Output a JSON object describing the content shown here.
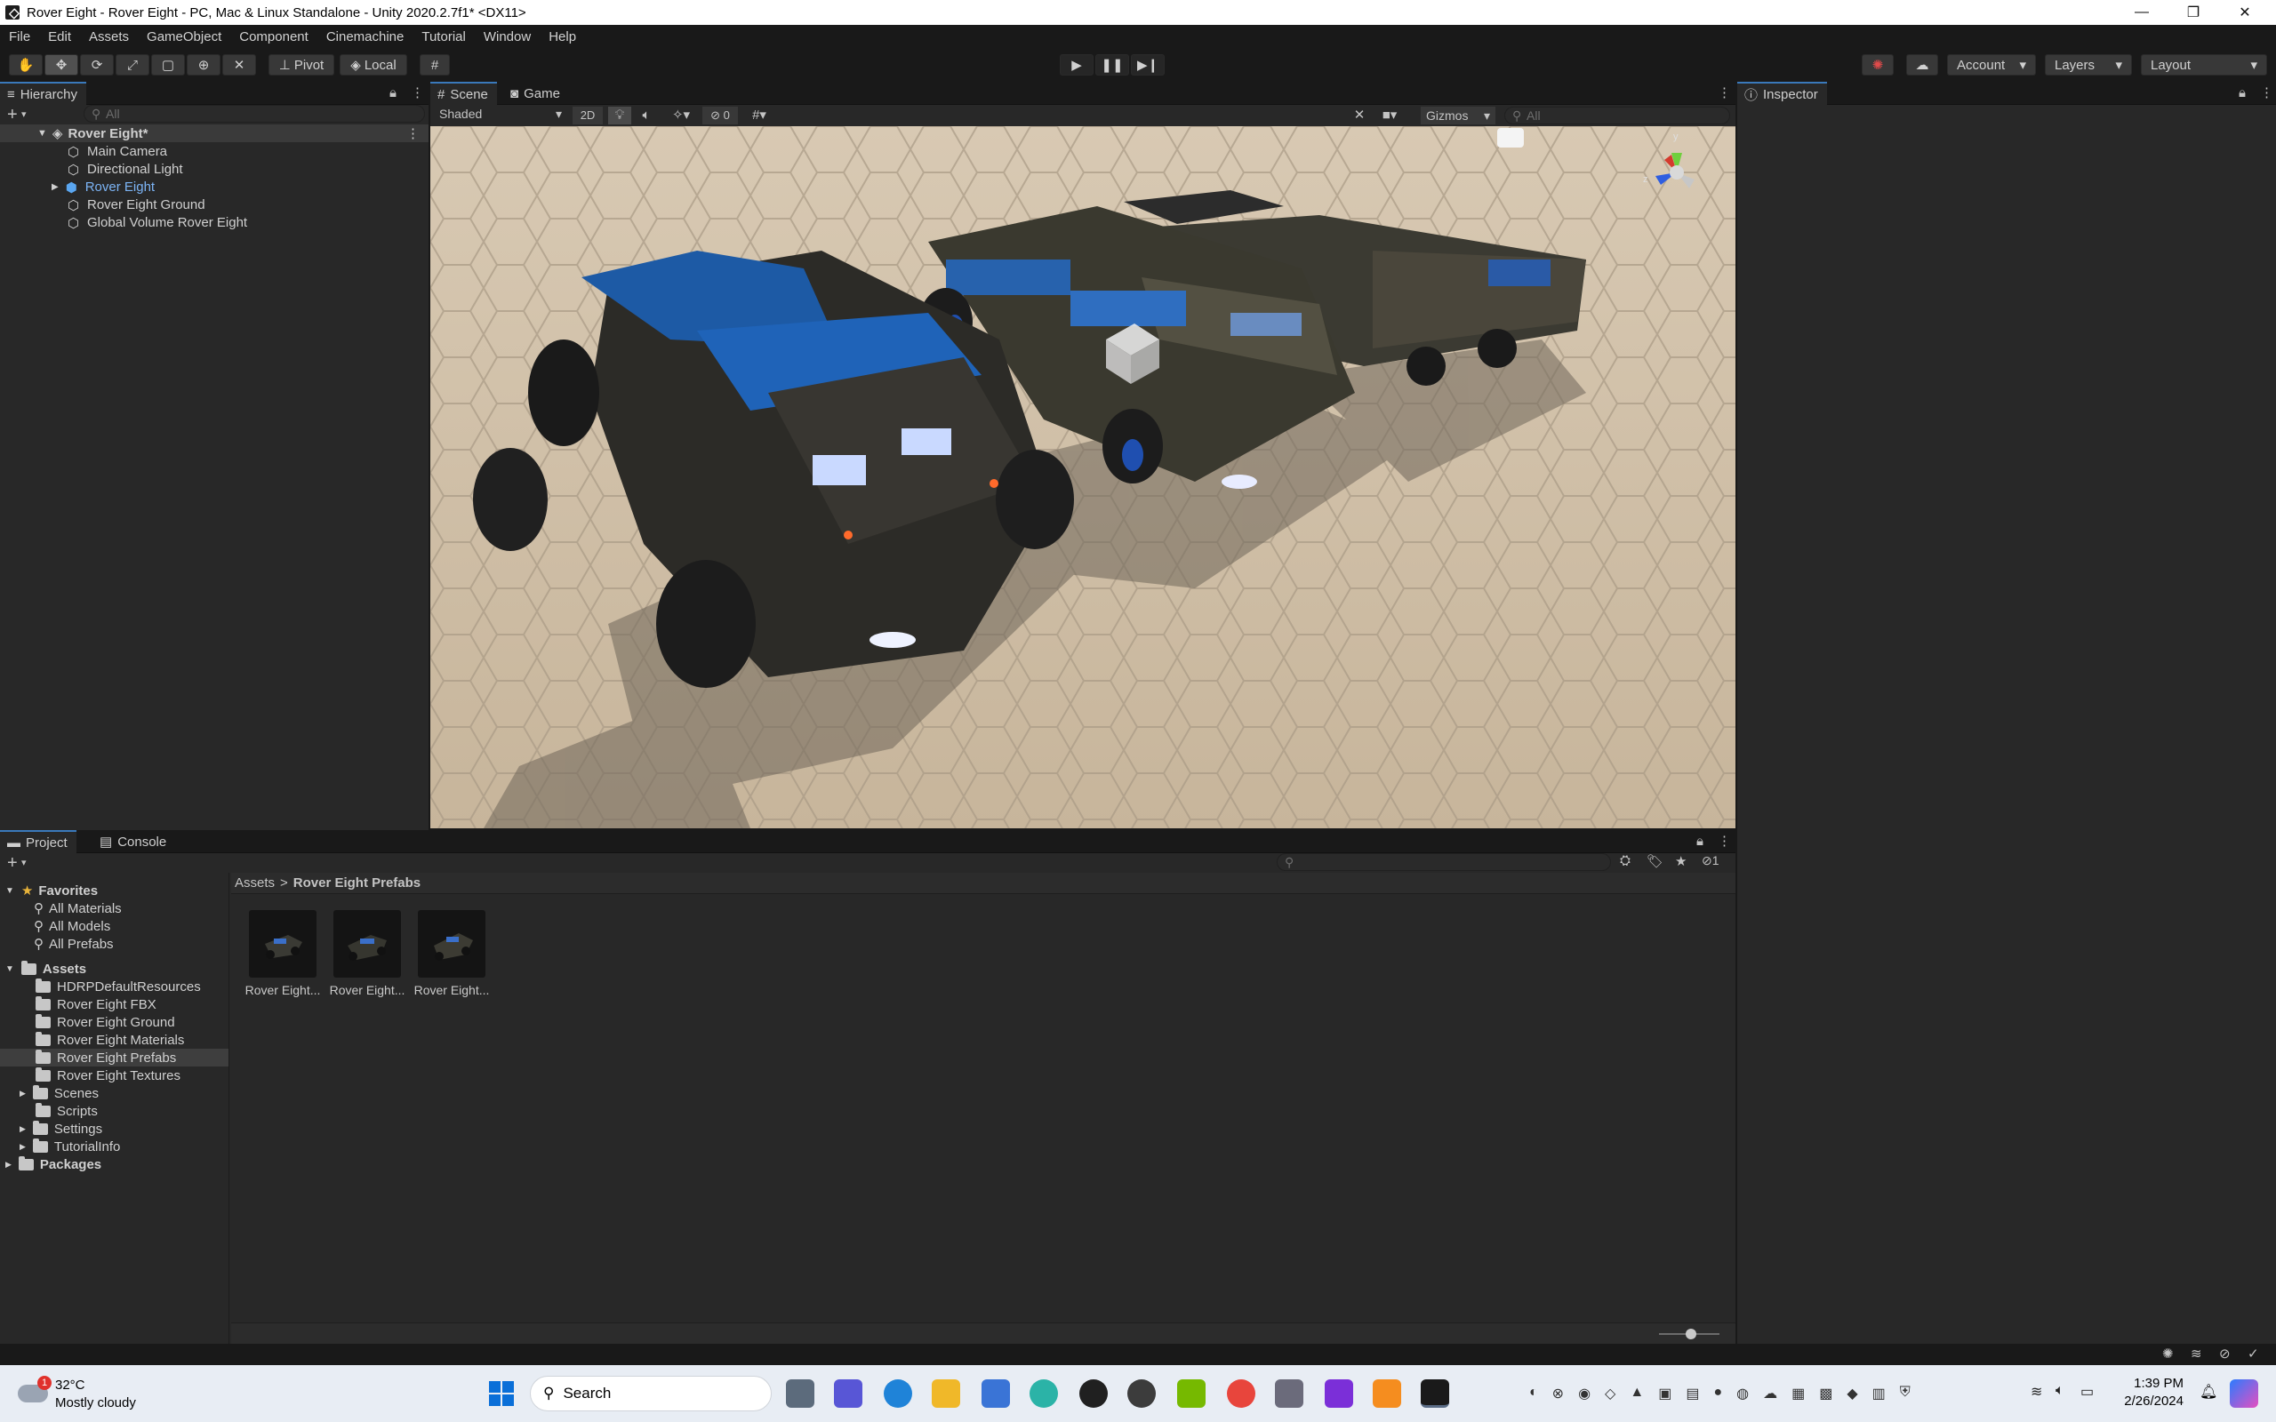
{
  "window": {
    "title": "Rover Eight - Rover Eight - PC, Mac & Linux Standalone - Unity 2020.2.7f1* <DX11>",
    "minimize": "—",
    "restore": "❐",
    "close": "✕"
  },
  "menu": [
    "File",
    "Edit",
    "Assets",
    "GameObject",
    "Component",
    "Cinemachine",
    "Tutorial",
    "Window",
    "Help"
  ],
  "toolbar": {
    "pivot": "Pivot",
    "local": "Local",
    "account": "Account",
    "layers": "Layers",
    "layout": "Layout"
  },
  "hierarchy": {
    "tab": "Hierarchy",
    "search_placeholder": "All",
    "scene": "Rover Eight*",
    "items": [
      "Main Camera",
      "Directional Light",
      "Rover Eight",
      "Rover Eight Ground",
      "Global Volume Rover Eight"
    ]
  },
  "scene": {
    "tabs": [
      "Scene",
      "Game"
    ],
    "shading": "Shaded",
    "mode_2d": "2D",
    "hidden_count": "0",
    "gizmos": "Gizmos",
    "search_placeholder": "All",
    "axis_y": "y",
    "axis_z": "z"
  },
  "inspector": {
    "tab": "Inspector"
  },
  "project": {
    "tabs": [
      "Project",
      "Console"
    ],
    "breadcrumb_root": "Assets",
    "breadcrumb_sep": ">",
    "breadcrumb_current": "Rover Eight Prefabs",
    "favorites_label": "Favorites",
    "favorites": [
      "All Materials",
      "All Models",
      "All Prefabs"
    ],
    "assets_label": "Assets",
    "folders": [
      "HDRPDefaultResources",
      "Rover Eight FBX",
      "Rover Eight Ground",
      "Rover Eight Materials",
      "Rover Eight Prefabs",
      "Rover Eight Textures",
      "Scenes",
      "Scripts",
      "Settings",
      "TutorialInfo"
    ],
    "packages_label": "Packages",
    "assets": [
      "Rover Eight...",
      "Rover Eight...",
      "Rover Eight..."
    ],
    "hidden_count": "1"
  },
  "taskbar": {
    "weather_temp": "32°C",
    "weather_desc": "Mostly cloudy",
    "weather_badge": "1",
    "search": "Search",
    "time": "1:39 PM",
    "date": "2/26/2024"
  },
  "colors": {
    "accent": "#3a79bb",
    "panel": "#282828",
    "chrome": "#191919"
  }
}
